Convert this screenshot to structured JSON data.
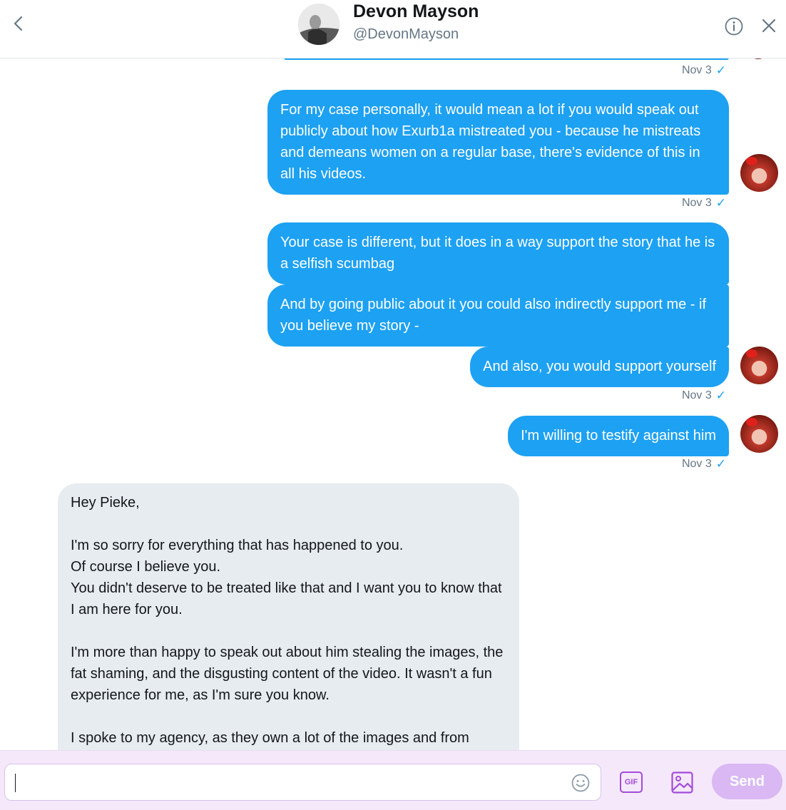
{
  "header": {
    "name": "Devon Mayson",
    "handle": "@DevonMayson",
    "icons": {
      "back": "chevron-left-icon",
      "info": "info-icon",
      "close": "close-icon"
    }
  },
  "messages": [
    {
      "direction": "sent",
      "text": "For my case personally, it would mean a lot if you would speak out publicly about how Exurb1a mistreated you - because he mistreats and demeans women on a regular base, there's evidence of this in all his videos."
    },
    {
      "direction": "sent",
      "text": "Your case is different, but it does in a way support the story that he is a selfish scumbag"
    },
    {
      "direction": "sent",
      "text": "And by going public about it you could also indirectly support me - if you believe my story -"
    },
    {
      "direction": "sent",
      "text": "And also, you would support yourself"
    },
    {
      "direction": "sent",
      "text": "I'm willing to testify against him"
    }
  ],
  "timestamps": [
    "Nov 3",
    "Nov 3",
    "Nov 3",
    "Nov 3"
  ],
  "received": {
    "lines": [
      "Hey Pieke,",
      "",
      "I'm so sorry for everything that has happened to you.",
      "Of course I believe you.",
      "You didn't deserve to be treated like that and I want you to know that I am here for you.",
      "",
      "I'm more than happy to speak out about him stealing the images, the fat shaming, and the disgusting content of the video. It wasn't a fun experience for me, as I'm sure you know.",
      "",
      "I spoke to my agency, as they own a lot of the images and from"
    ]
  },
  "composer": {
    "value": "",
    "placeholder": "",
    "gif_label": "GIF",
    "send_label": "Send",
    "icons": {
      "emoji": "emoji-icon",
      "gif": "gif-icon",
      "media": "image-icon"
    }
  },
  "colors": {
    "sent_bubble": "#1da1f2",
    "received_bubble": "#e6ecf0",
    "composer_bg": "#f5e8fb",
    "accent_purple": "#a24bd8",
    "send_disabled": "#d9b8f3",
    "timestamp": "#657786"
  }
}
